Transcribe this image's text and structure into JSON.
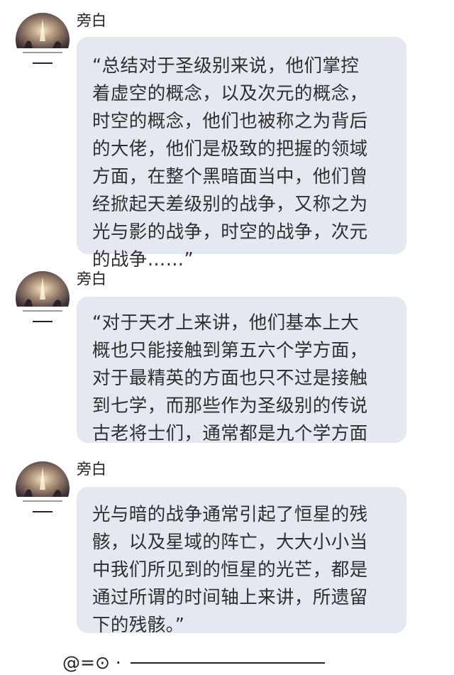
{
  "messages": [
    {
      "sender": "旁白",
      "text": "“总结对于圣级别来说，他们掌控\n着虚空的概念，以及次元的概念，\n时空的概念，他们也被称之为背后\n的大佬，他们是极致的把握的领域\n方面，在整个黑暗面当中，他们曾\n经掀起天差级别的战争，又称之为\n光与影的战争，时空的战争，次元\n的战争……”"
    },
    {
      "sender": "旁白",
      "text": "“对于天才上来讲，他们基本上大\n概也只能接触到第五六个学方面，\n对于最精英的方面也只不过是接触\n到七学，而那些作为圣级别的传说\n古老将士们，通常都是九个学方面"
    },
    {
      "sender": "旁白",
      "text": "光与暗的战争通常引起了恒星的残\n骸，以及星域的阵亡，大大小小当\n中我们所见到的恒星的光芒，都是\n通过所谓的时间轴上来讲，所遗留\n下的残骸。”"
    }
  ],
  "footer": {
    "emoticon": "@=⊙ ·"
  }
}
